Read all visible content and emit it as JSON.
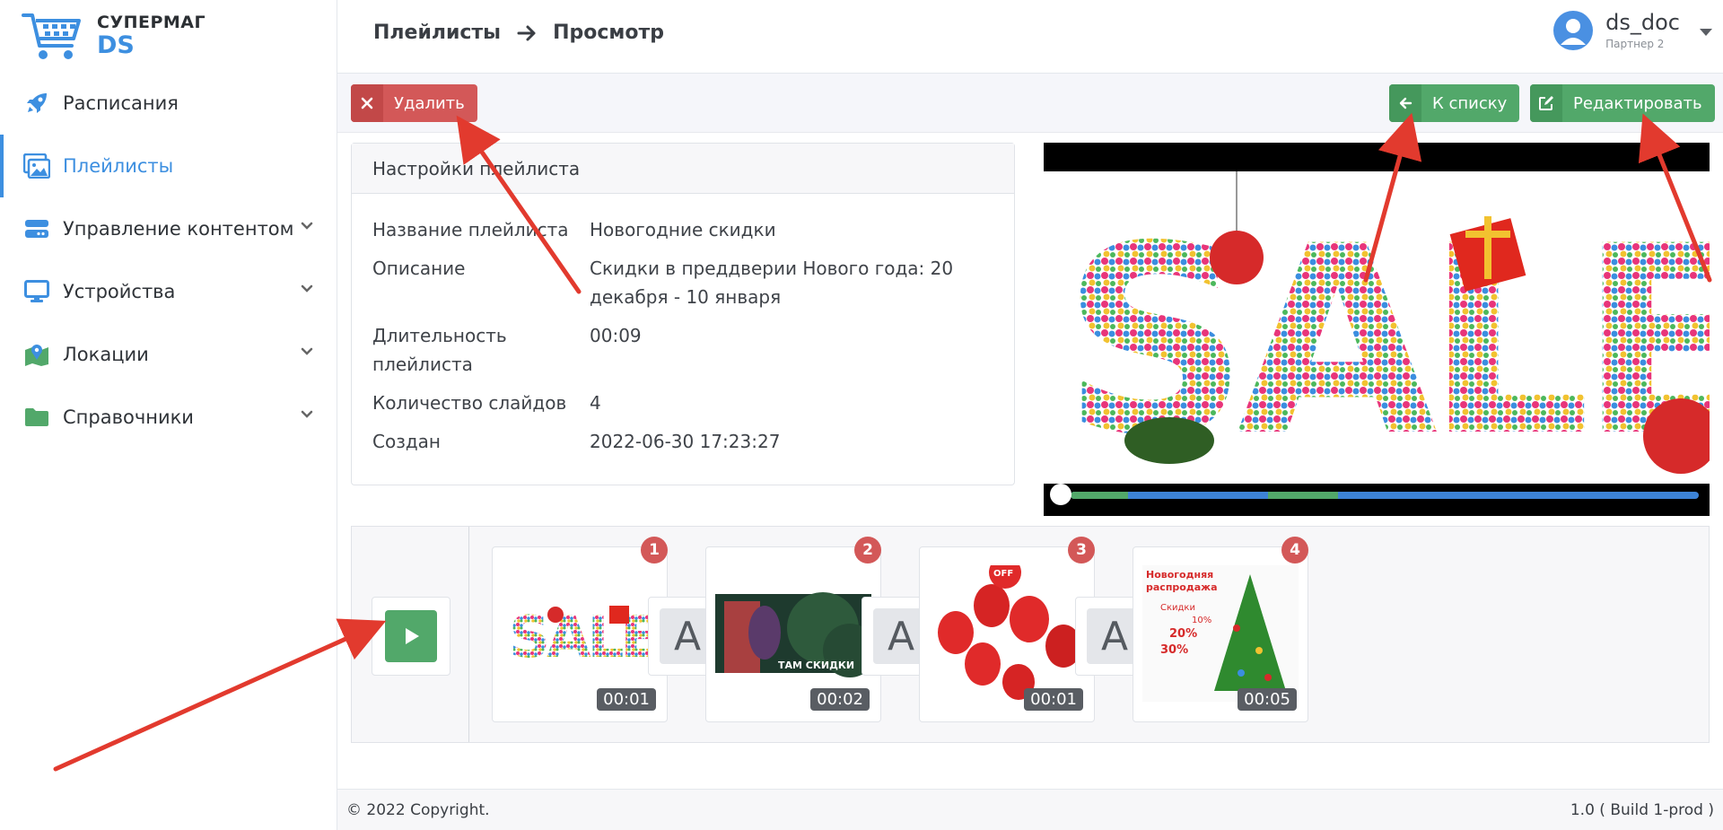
{
  "brand": {
    "name": "СУПЕРМАГ",
    "sub": "DS"
  },
  "sidebar": {
    "items": [
      {
        "label": "Расписания",
        "icon": "rocket-icon"
      },
      {
        "label": "Плейлисты",
        "icon": "images-icon",
        "active": true
      },
      {
        "label": "Управление контентом",
        "icon": "server-icon",
        "expandable": true
      },
      {
        "label": "Устройства",
        "icon": "monitor-icon",
        "expandable": true
      },
      {
        "label": "Локации",
        "icon": "map-icon",
        "expandable": true
      },
      {
        "label": "Справочники",
        "icon": "folder-icon",
        "expandable": true
      }
    ]
  },
  "header": {
    "breadcrumb": [
      "Плейлисты",
      "Просмотр"
    ],
    "user": {
      "name": "ds_doc",
      "role": "Партнер 2"
    }
  },
  "toolbar": {
    "delete_label": "Удалить",
    "back_label": "К списку",
    "edit_label": "Редактировать"
  },
  "settings": {
    "title": "Настройки плейлиста",
    "fields": [
      {
        "key": "Название плейлиста",
        "value": "Новогодние скидки"
      },
      {
        "key": "Описание",
        "value": "Скидки в преддверии Нового года: 20 декабря - 10 января"
      },
      {
        "key": "Длительность плейлиста",
        "value": "00:09"
      },
      {
        "key": "Количество слайдов",
        "value": "4"
      },
      {
        "key": "Создан",
        "value": "2022-06-30 17:23:27"
      }
    ]
  },
  "preview": {
    "progress": 0
  },
  "slides": [
    {
      "number": "1",
      "duration": "00:01",
      "thumb_text": "SALE"
    },
    {
      "number": "2",
      "duration": "00:02",
      "thumb_text": "ТАМ СКИДКИ"
    },
    {
      "number": "3",
      "duration": "00:01",
      "thumb_text": "OFF"
    },
    {
      "number": "4",
      "duration": "00:05",
      "thumb_text": "Новогодняя распродажа"
    }
  ],
  "slide4_lines": [
    "Новогодняя",
    "распродажа",
    "Скидки",
    "10%",
    "20%",
    "30%"
  ],
  "transitions": [
    "A",
    "A",
    "A"
  ],
  "footer": {
    "copyright": "© 2022 Copyright.",
    "version": "1.0 ( Build 1-prod )"
  },
  "colors": {
    "accent": "#3d8fe0",
    "danger": "#d35858",
    "success": "#52a86a"
  }
}
